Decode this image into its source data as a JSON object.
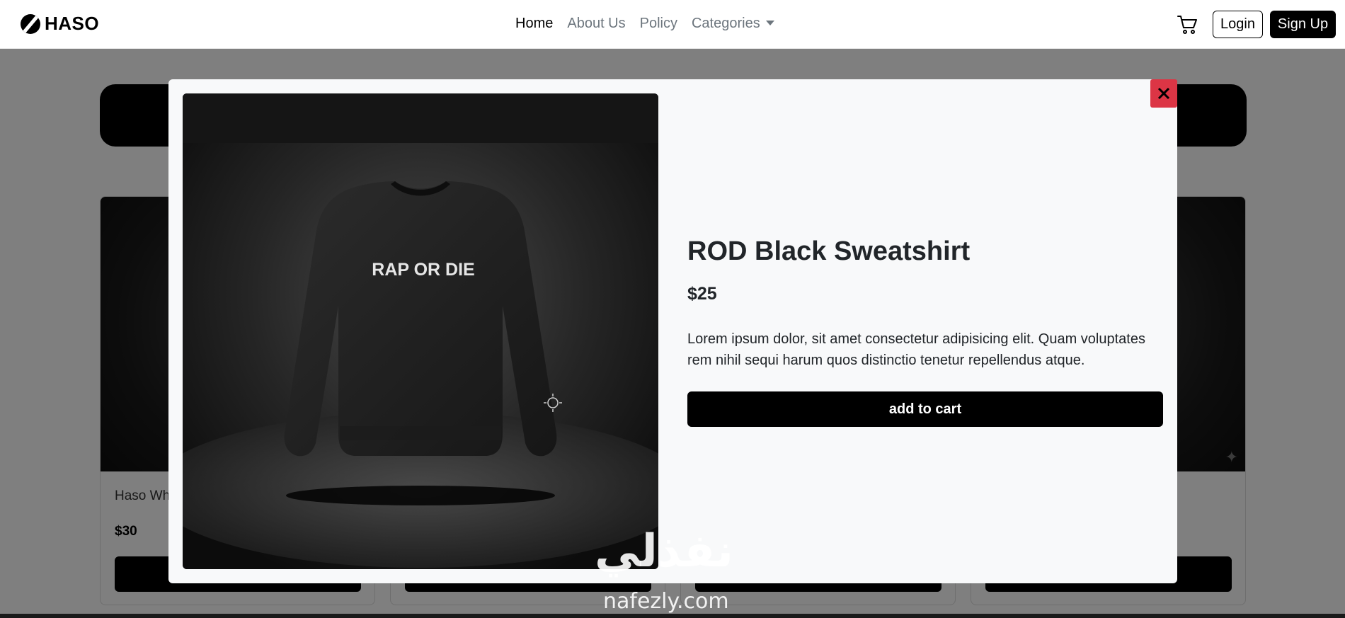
{
  "navbar": {
    "brand": "HASO",
    "links": [
      {
        "label": "Home",
        "active": true
      },
      {
        "label": "About Us",
        "active": false
      },
      {
        "label": "Policy",
        "active": false
      },
      {
        "label": "Categories",
        "active": false
      }
    ],
    "cart_icon": "cart-icon",
    "login_label": "Login",
    "signup_label": "Sign Up"
  },
  "background_cards": [
    {
      "title": "Haso Wh",
      "price": "$30"
    }
  ],
  "modal": {
    "title": "ROD Black Sweatshirt",
    "price": "$25",
    "description": "Lorem ipsum dolor, sit amet consectetur adipisicing elit. Quam voluptates rem nihil sequi harum quos distinctio tenetur repellendus atque.",
    "add_to_cart_label": "add to cart",
    "image_print_text": "RAP OR DIE",
    "close_icon": "close-icon",
    "close_color": "#dc3545"
  },
  "watermark": {
    "arabic": "نفذلي",
    "latin": "nafezly.com"
  }
}
